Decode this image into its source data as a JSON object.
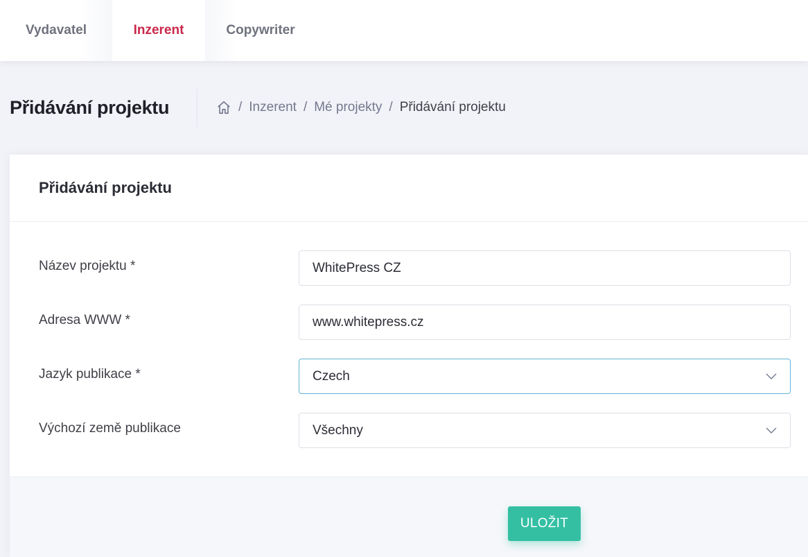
{
  "topnav": {
    "tabs": [
      {
        "label": "Vydavatel",
        "active": false
      },
      {
        "label": "Inzerent",
        "active": true
      },
      {
        "label": "Copywriter",
        "active": false
      }
    ],
    "active_color": "#c9284b"
  },
  "subheader": {
    "title": "Přidávání projektu",
    "breadcrumb": {
      "home_icon": "home-icon",
      "separator": "/",
      "items": [
        "Inzerent",
        "Mé projekty",
        "Přidávání projektu"
      ]
    }
  },
  "card": {
    "title": "Přidávání projektu",
    "fields": [
      {
        "label": "Název projektu *",
        "value": "WhitePress CZ",
        "type": "text"
      },
      {
        "label": "Adresa WWW *",
        "value": "www.whitepress.cz",
        "type": "text"
      },
      {
        "label": "Jazyk publikace *",
        "value": "Czech",
        "type": "select",
        "icon": "chevron-down-icon"
      },
      {
        "label": "Výchozí země publikace",
        "value": "Všechny",
        "type": "select",
        "icon": "chevron-down-icon"
      }
    ],
    "save_label": "ULOŽIT",
    "save_color": "#34bfa3"
  }
}
